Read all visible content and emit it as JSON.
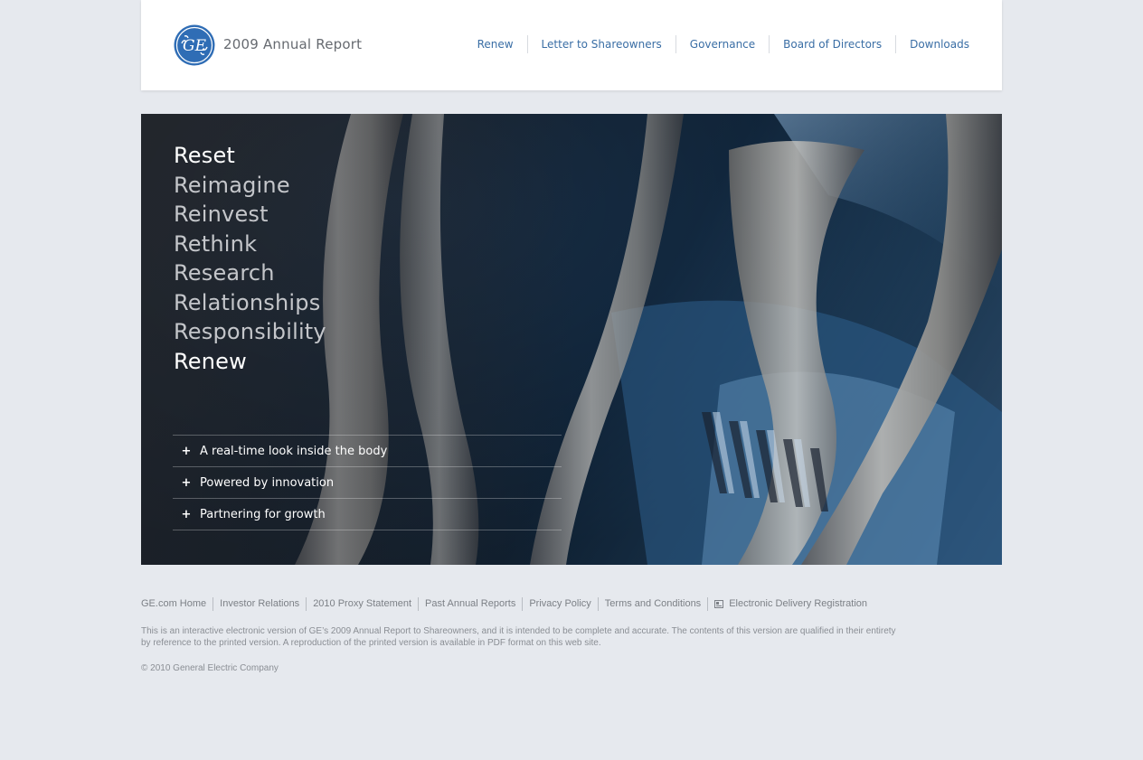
{
  "header": {
    "logo_text": "GE",
    "report_title": "2009 Annual Report",
    "nav": [
      {
        "label": "Renew"
      },
      {
        "label": "Letter to Shareowners"
      },
      {
        "label": "Governance"
      },
      {
        "label": "Board of Directors"
      },
      {
        "label": "Downloads"
      }
    ]
  },
  "hero": {
    "words": [
      "Reset",
      "Reimagine",
      "Reinvest",
      "Rethink",
      "Research",
      "Relationships",
      "Responsibility",
      "Renew"
    ],
    "stories": [
      {
        "label": "A real-time look inside the body"
      },
      {
        "label": "Powered by innovation"
      },
      {
        "label": "Partnering for growth"
      }
    ],
    "icons": {
      "expand": "plus-icon"
    }
  },
  "footer": {
    "links": [
      {
        "label": "GE.com Home"
      },
      {
        "label": "Investor Relations"
      },
      {
        "label": "2010 Proxy Statement"
      },
      {
        "label": "Past Annual Reports"
      },
      {
        "label": "Privacy Policy"
      },
      {
        "label": "Terms and Conditions"
      },
      {
        "label": "Electronic Delivery Registration",
        "icon": "document-icon"
      }
    ],
    "disclaimer": "This is an interactive electronic version of GE’s 2009 Annual Report to Shareowners, and it is intended to be complete and accurate. The contents of this version are qualified in their entirety by reference to the printed version. A reproduction of the printed version is available in PDF format on this web site.",
    "copyright": "© 2010 General Electric Company"
  },
  "colors": {
    "page_bg": "#e6e9ee",
    "nav_link": "#3a6ea5",
    "ge_blue": "#2f6db5",
    "footer_text": "#7c8086"
  }
}
